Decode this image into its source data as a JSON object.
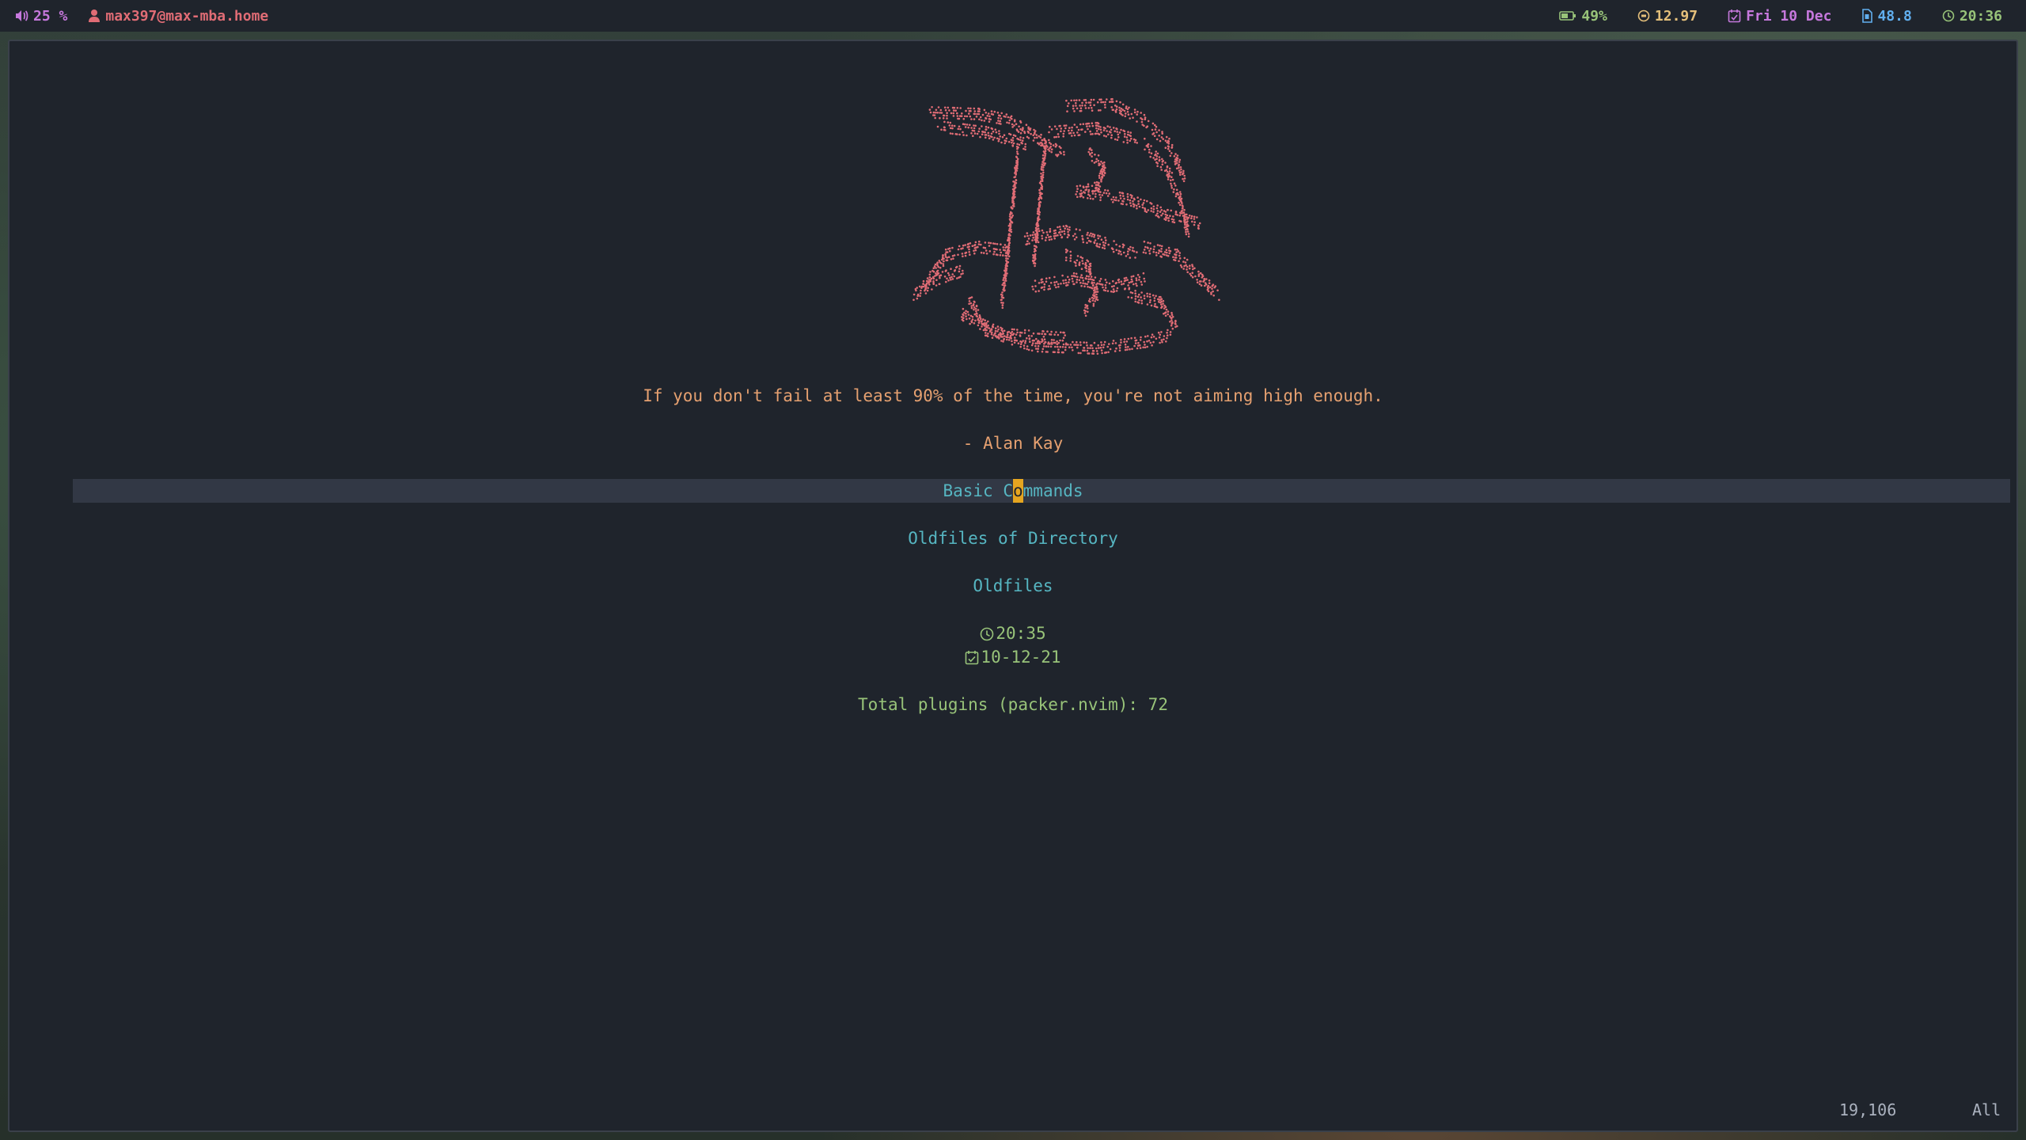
{
  "statusbar": {
    "volume": "25 %",
    "volume_icon": "speaker-icon",
    "user": "max397@max-mba.home",
    "user_icon": "user-icon",
    "battery": "49%",
    "battery_icon": "battery-icon",
    "coin": "12.97",
    "coin_icon": "coin-icon",
    "date": "Fri 10 Dec",
    "date_icon": "calendar-icon",
    "memory": "48.8",
    "memory_icon": "memory-icon",
    "clock": "20:36",
    "clock_icon": "clock-icon"
  },
  "dashboard": {
    "header_art": "ascii-art-logo",
    "quote": "If you don't fail at least 90% of the time, you're not aiming high enough.",
    "author": "- Alan Kay",
    "buttons": [
      {
        "label_before": "Basic C",
        "label_cursor": "o",
        "label_after": "mmands"
      },
      {
        "label": "Oldfiles of Directory"
      },
      {
        "label": "Oldfiles"
      }
    ],
    "footer": {
      "time": "20:35",
      "date": "10-12-21",
      "plugins": "Total plugins (packer.nvim): 72"
    }
  },
  "ruler": {
    "position": "19,106",
    "percent": "All"
  },
  "colors": {
    "background": "#1f242c",
    "art": "#e06c75",
    "quote": "#e5a070",
    "buttons": "#56b6c2",
    "footer": "#98c379",
    "cursor": "#e5a520"
  }
}
